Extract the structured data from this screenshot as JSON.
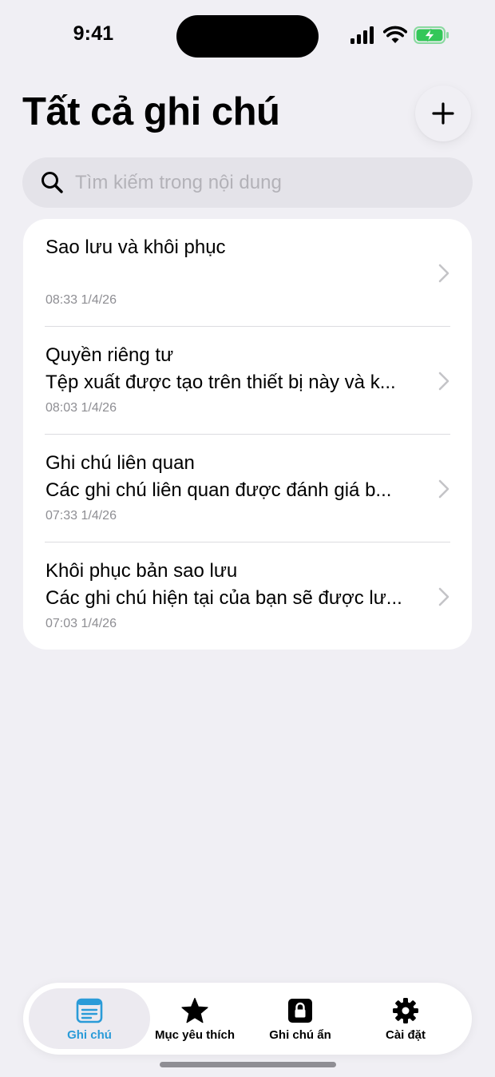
{
  "status_bar": {
    "time": "9:41"
  },
  "header": {
    "title": "Tất cả ghi chú",
    "add_icon": "plus-icon"
  },
  "search": {
    "placeholder": "Tìm kiếm trong nội dung",
    "value": ""
  },
  "notes": [
    {
      "title": "Sao lưu và khôi phục",
      "preview": "",
      "time": "08:33 1/4/26"
    },
    {
      "title": "Quyền riêng tư",
      "preview": "Tệp xuất được tạo trên thiết bị này và k...",
      "time": "08:03 1/4/26"
    },
    {
      "title": "Ghi chú liên quan",
      "preview": "Các ghi chú liên quan được đánh giá b...",
      "time": "07:33 1/4/26"
    },
    {
      "title": "Khôi phục bản sao lưu",
      "preview": "Các ghi chú hiện tại của bạn sẽ được lư...",
      "time": "07:03 1/4/26"
    }
  ],
  "tab_bar": {
    "tabs": [
      {
        "label": "Ghi chú",
        "icon": "notes-icon",
        "active": true
      },
      {
        "label": "Mục yêu thích",
        "icon": "star-icon",
        "active": false
      },
      {
        "label": "Ghi chú ẩn",
        "icon": "lock-icon",
        "active": false
      },
      {
        "label": "Cài đặt",
        "icon": "gear-icon",
        "active": false
      }
    ]
  },
  "colors": {
    "background": "#f0eff4",
    "accent": "#2a9bd8",
    "battery": "#34c759",
    "secondary_text": "#8e8e93"
  }
}
